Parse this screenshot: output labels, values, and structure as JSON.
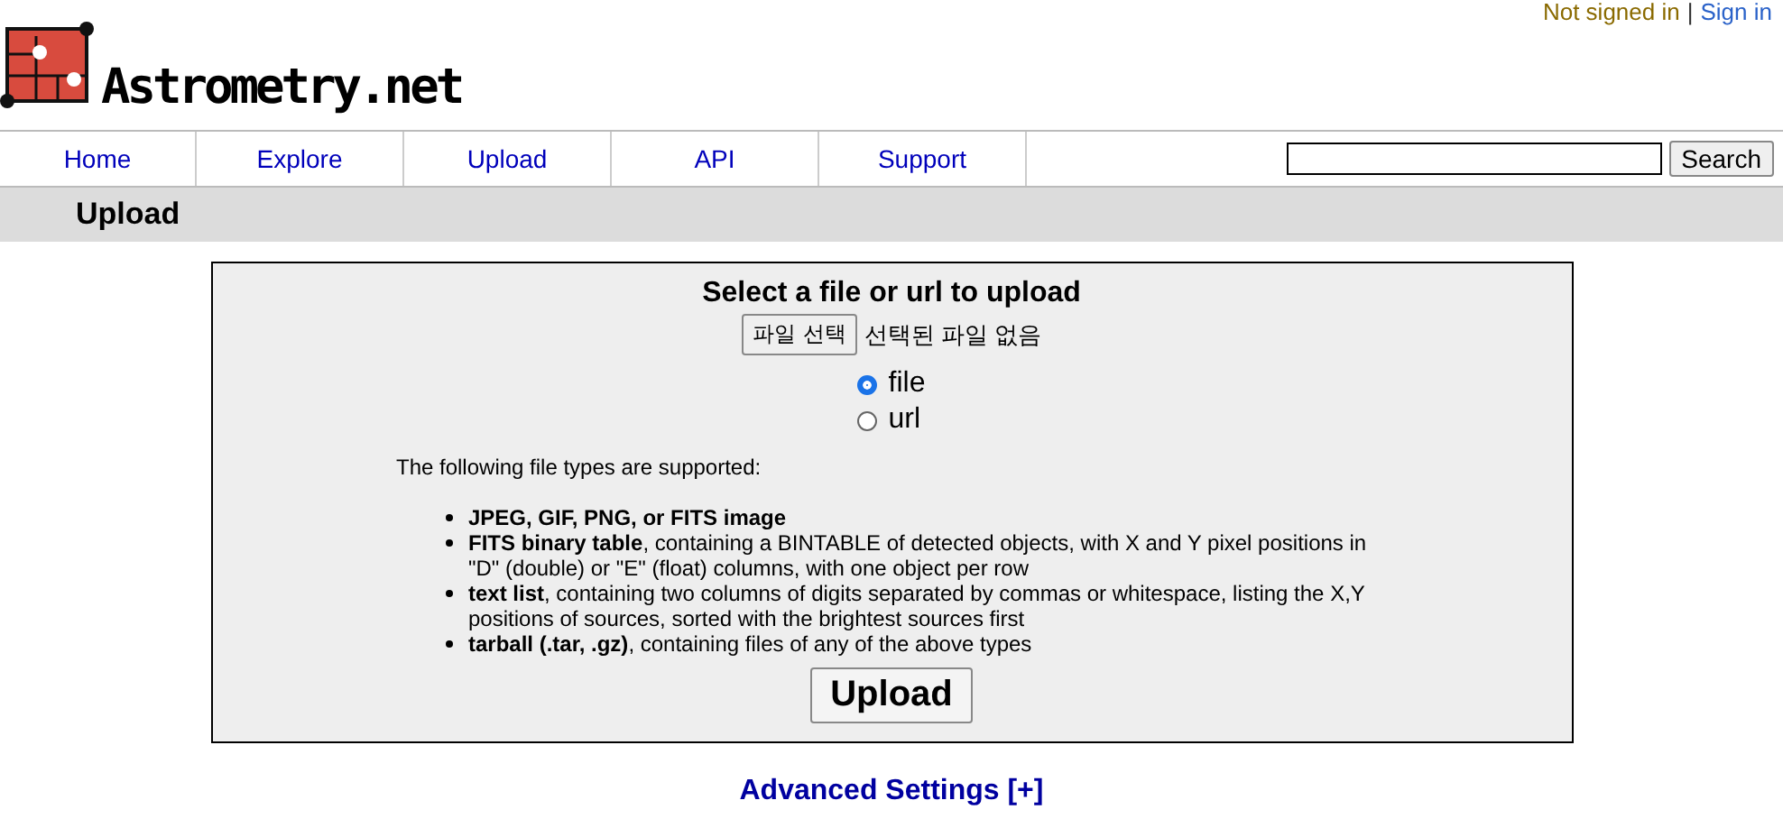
{
  "header": {
    "logo_text": "Astrometry.net",
    "status": "Not signed in",
    "separator": "|",
    "sign_in": "Sign in"
  },
  "nav": {
    "items": [
      "Home",
      "Explore",
      "Upload",
      "API",
      "Support"
    ],
    "search_button": "Search"
  },
  "page_title": "Upload",
  "form": {
    "heading": "Select a file or url to upload",
    "file_button": "파일 선택",
    "file_status": "선택된 파일 없음",
    "sources": [
      {
        "label": "file",
        "selected": true
      },
      {
        "label": "url",
        "selected": false
      }
    ],
    "intro": "The following file types are supported:",
    "file_types": [
      "**JPEG, GIF, PNG, or FITS image**",
      "**FITS binary table**, containing a BINTABLE of detected objects, with X and Y pixel positions in \"D\" (double) or \"E\" (float) columns, with one object per row",
      "**text list**, containing two columns of digits separated by commas or whitespace, listing the X,Y positions of sources, sorted with the brightest sources first",
      "**tarball (.tar, .gz)**, containing files of any of the above types"
    ],
    "submit": "Upload"
  },
  "advanced_link": "Advanced Settings [+]"
}
